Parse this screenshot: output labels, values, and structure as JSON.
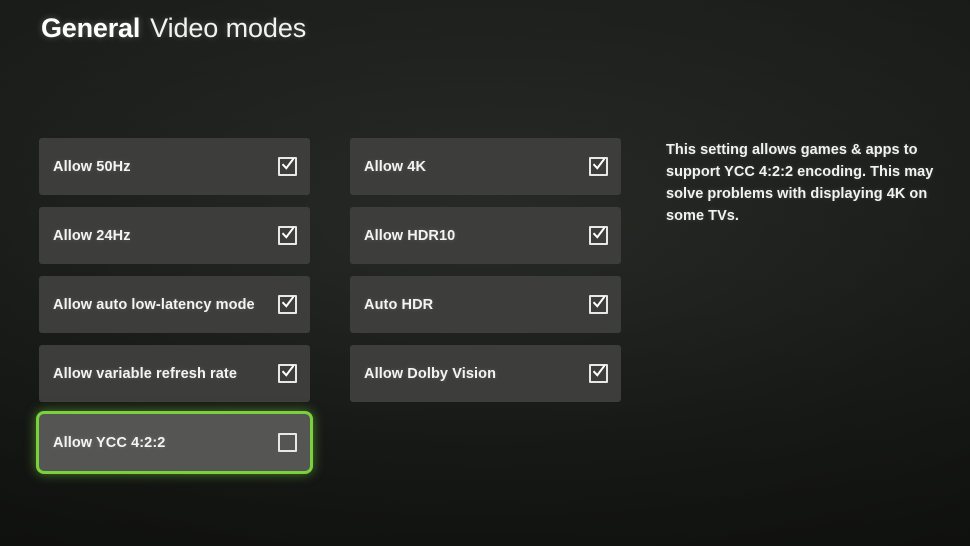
{
  "header": {
    "breadcrumb_primary": "General",
    "breadcrumb_secondary": "Video modes"
  },
  "colors": {
    "background": "#1b1d1b",
    "row_background": "#3d3d3b",
    "row_focused_background": "#555553",
    "focus_outline": "#79d13c",
    "text": "#f4f4f4",
    "checkbox_outline": "#e8e8e8"
  },
  "columns": [
    {
      "id": "column-one",
      "rows": [
        {
          "label": "Allow 50Hz",
          "checked": true,
          "focused": false,
          "icon": "checkbox-checked-icon"
        },
        {
          "label": "Allow 24Hz",
          "checked": true,
          "focused": false,
          "icon": "checkbox-checked-icon"
        },
        {
          "label": "Allow auto low-latency mode",
          "checked": true,
          "focused": false,
          "icon": "checkbox-checked-icon"
        },
        {
          "label": "Allow variable refresh rate",
          "checked": true,
          "focused": false,
          "icon": "checkbox-checked-icon"
        },
        {
          "label": "Allow YCC 4:2:2",
          "checked": false,
          "focused": true,
          "icon": "checkbox-unchecked-icon"
        }
      ]
    },
    {
      "id": "column-two",
      "rows": [
        {
          "label": "Allow 4K",
          "checked": true,
          "focused": false,
          "icon": "checkbox-checked-icon"
        },
        {
          "label": "Allow HDR10",
          "checked": true,
          "focused": false,
          "icon": "checkbox-checked-icon"
        },
        {
          "label": "Auto HDR",
          "checked": true,
          "focused": false,
          "icon": "checkbox-checked-icon"
        },
        {
          "label": "Allow Dolby Vision",
          "checked": true,
          "focused": false,
          "icon": "checkbox-checked-icon"
        }
      ]
    }
  ],
  "description": {
    "text": "This setting allows games & apps to support YCC 4:2:2 encoding. This may solve problems with displaying 4K on some TVs."
  }
}
